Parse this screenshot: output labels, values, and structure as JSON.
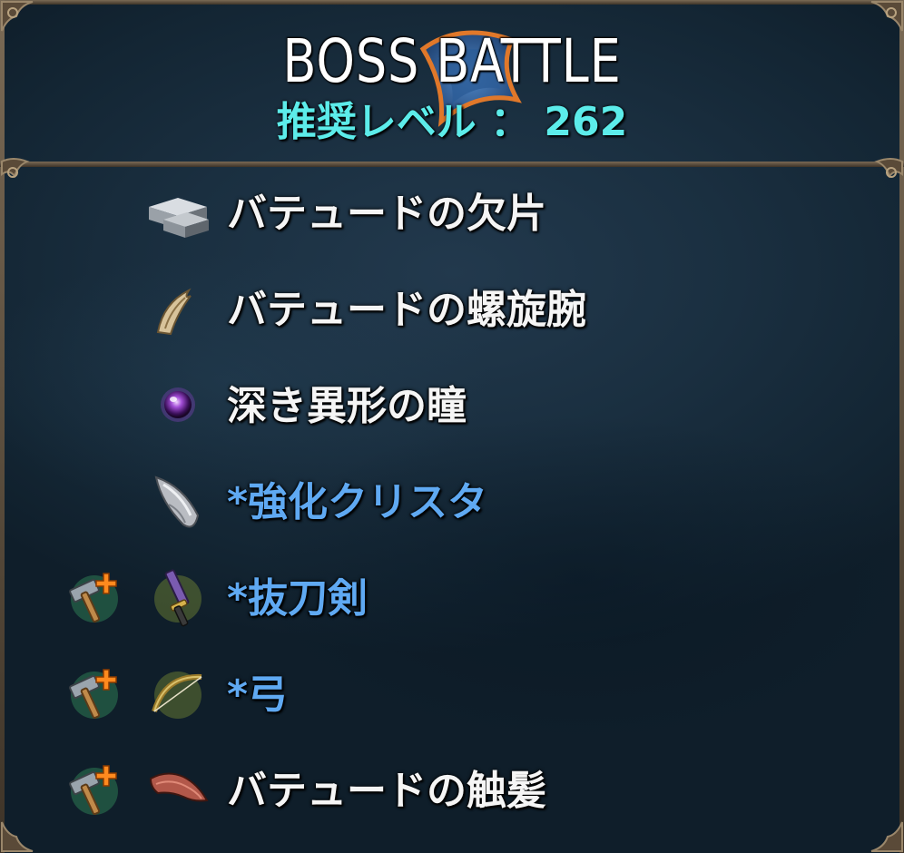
{
  "header": {
    "title": "BOSS BATTLE",
    "recommended_level": "推奨レベル ： 262"
  },
  "colors": {
    "title": "#ffffff",
    "level": "#5cecea",
    "item_normal": "#f5f5f5",
    "item_special": "#5fa9f2",
    "frame": "#6e5f4c"
  },
  "drops": [
    {
      "name": "バテュードの欠片",
      "icon": "metal-ingot-icon",
      "special": false,
      "upgrade": false
    },
    {
      "name": "バテュードの螺旋腕",
      "icon": "horn-claw-icon",
      "special": false,
      "upgrade": false
    },
    {
      "name": "深き異形の瞳",
      "icon": "purple-orb-icon",
      "special": false,
      "upgrade": false
    },
    {
      "name": "*強化クリスタ",
      "icon": "crystal-shard-icon",
      "special": true,
      "upgrade": false
    },
    {
      "name": "*抜刀剣",
      "icon": "katana-icon",
      "special": true,
      "upgrade": true
    },
    {
      "name": "*弓",
      "icon": "bow-icon",
      "special": true,
      "upgrade": true
    },
    {
      "name": "バテュードの触髪",
      "icon": "tentacle-hair-icon",
      "special": false,
      "upgrade": true
    }
  ],
  "upgrade_icon": "hammer-plus-icon"
}
